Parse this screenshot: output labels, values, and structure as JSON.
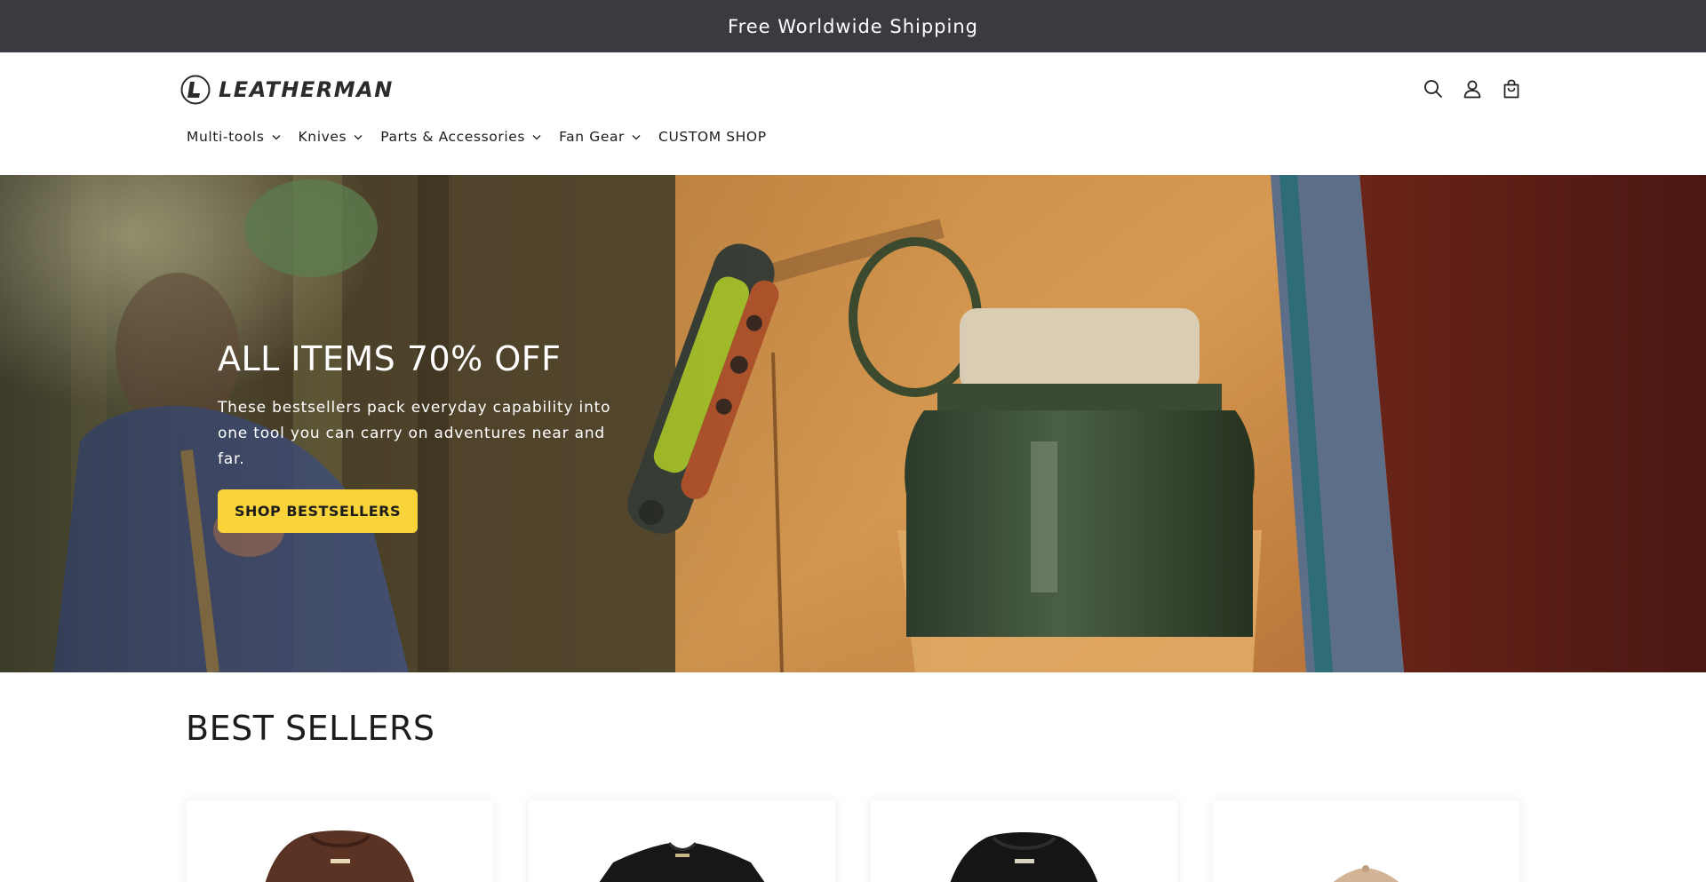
{
  "announcement": {
    "text": "Free Worldwide Shipping"
  },
  "header": {
    "logo_text": "LEATHERMAN",
    "icons": [
      "search-icon",
      "account-icon",
      "cart-icon"
    ],
    "nav": [
      {
        "label": "Multi-tools",
        "has_dropdown": true
      },
      {
        "label": "Knives",
        "has_dropdown": true
      },
      {
        "label": "Parts & Accessories",
        "has_dropdown": true
      },
      {
        "label": "Fan Gear",
        "has_dropdown": true
      },
      {
        "label": "CUSTOM SHOP",
        "has_dropdown": false
      }
    ]
  },
  "hero": {
    "title": "ALL ITEMS 70% OFF",
    "subtitle": "These bestsellers pack everyday capability into one tool you can carry on adventures near and far.",
    "button_label": "SHOP BESTSELLERS"
  },
  "best_sellers": {
    "title": "BEST SELLERS",
    "products": [
      {
        "type": "brown-hoodie"
      },
      {
        "type": "black-tshirt"
      },
      {
        "type": "black-hoodie"
      },
      {
        "type": "tan-cap"
      }
    ]
  },
  "colors": {
    "announcement_bg": "#3a3b40",
    "button": "#f9d33a",
    "text": "#1c1c1c"
  }
}
